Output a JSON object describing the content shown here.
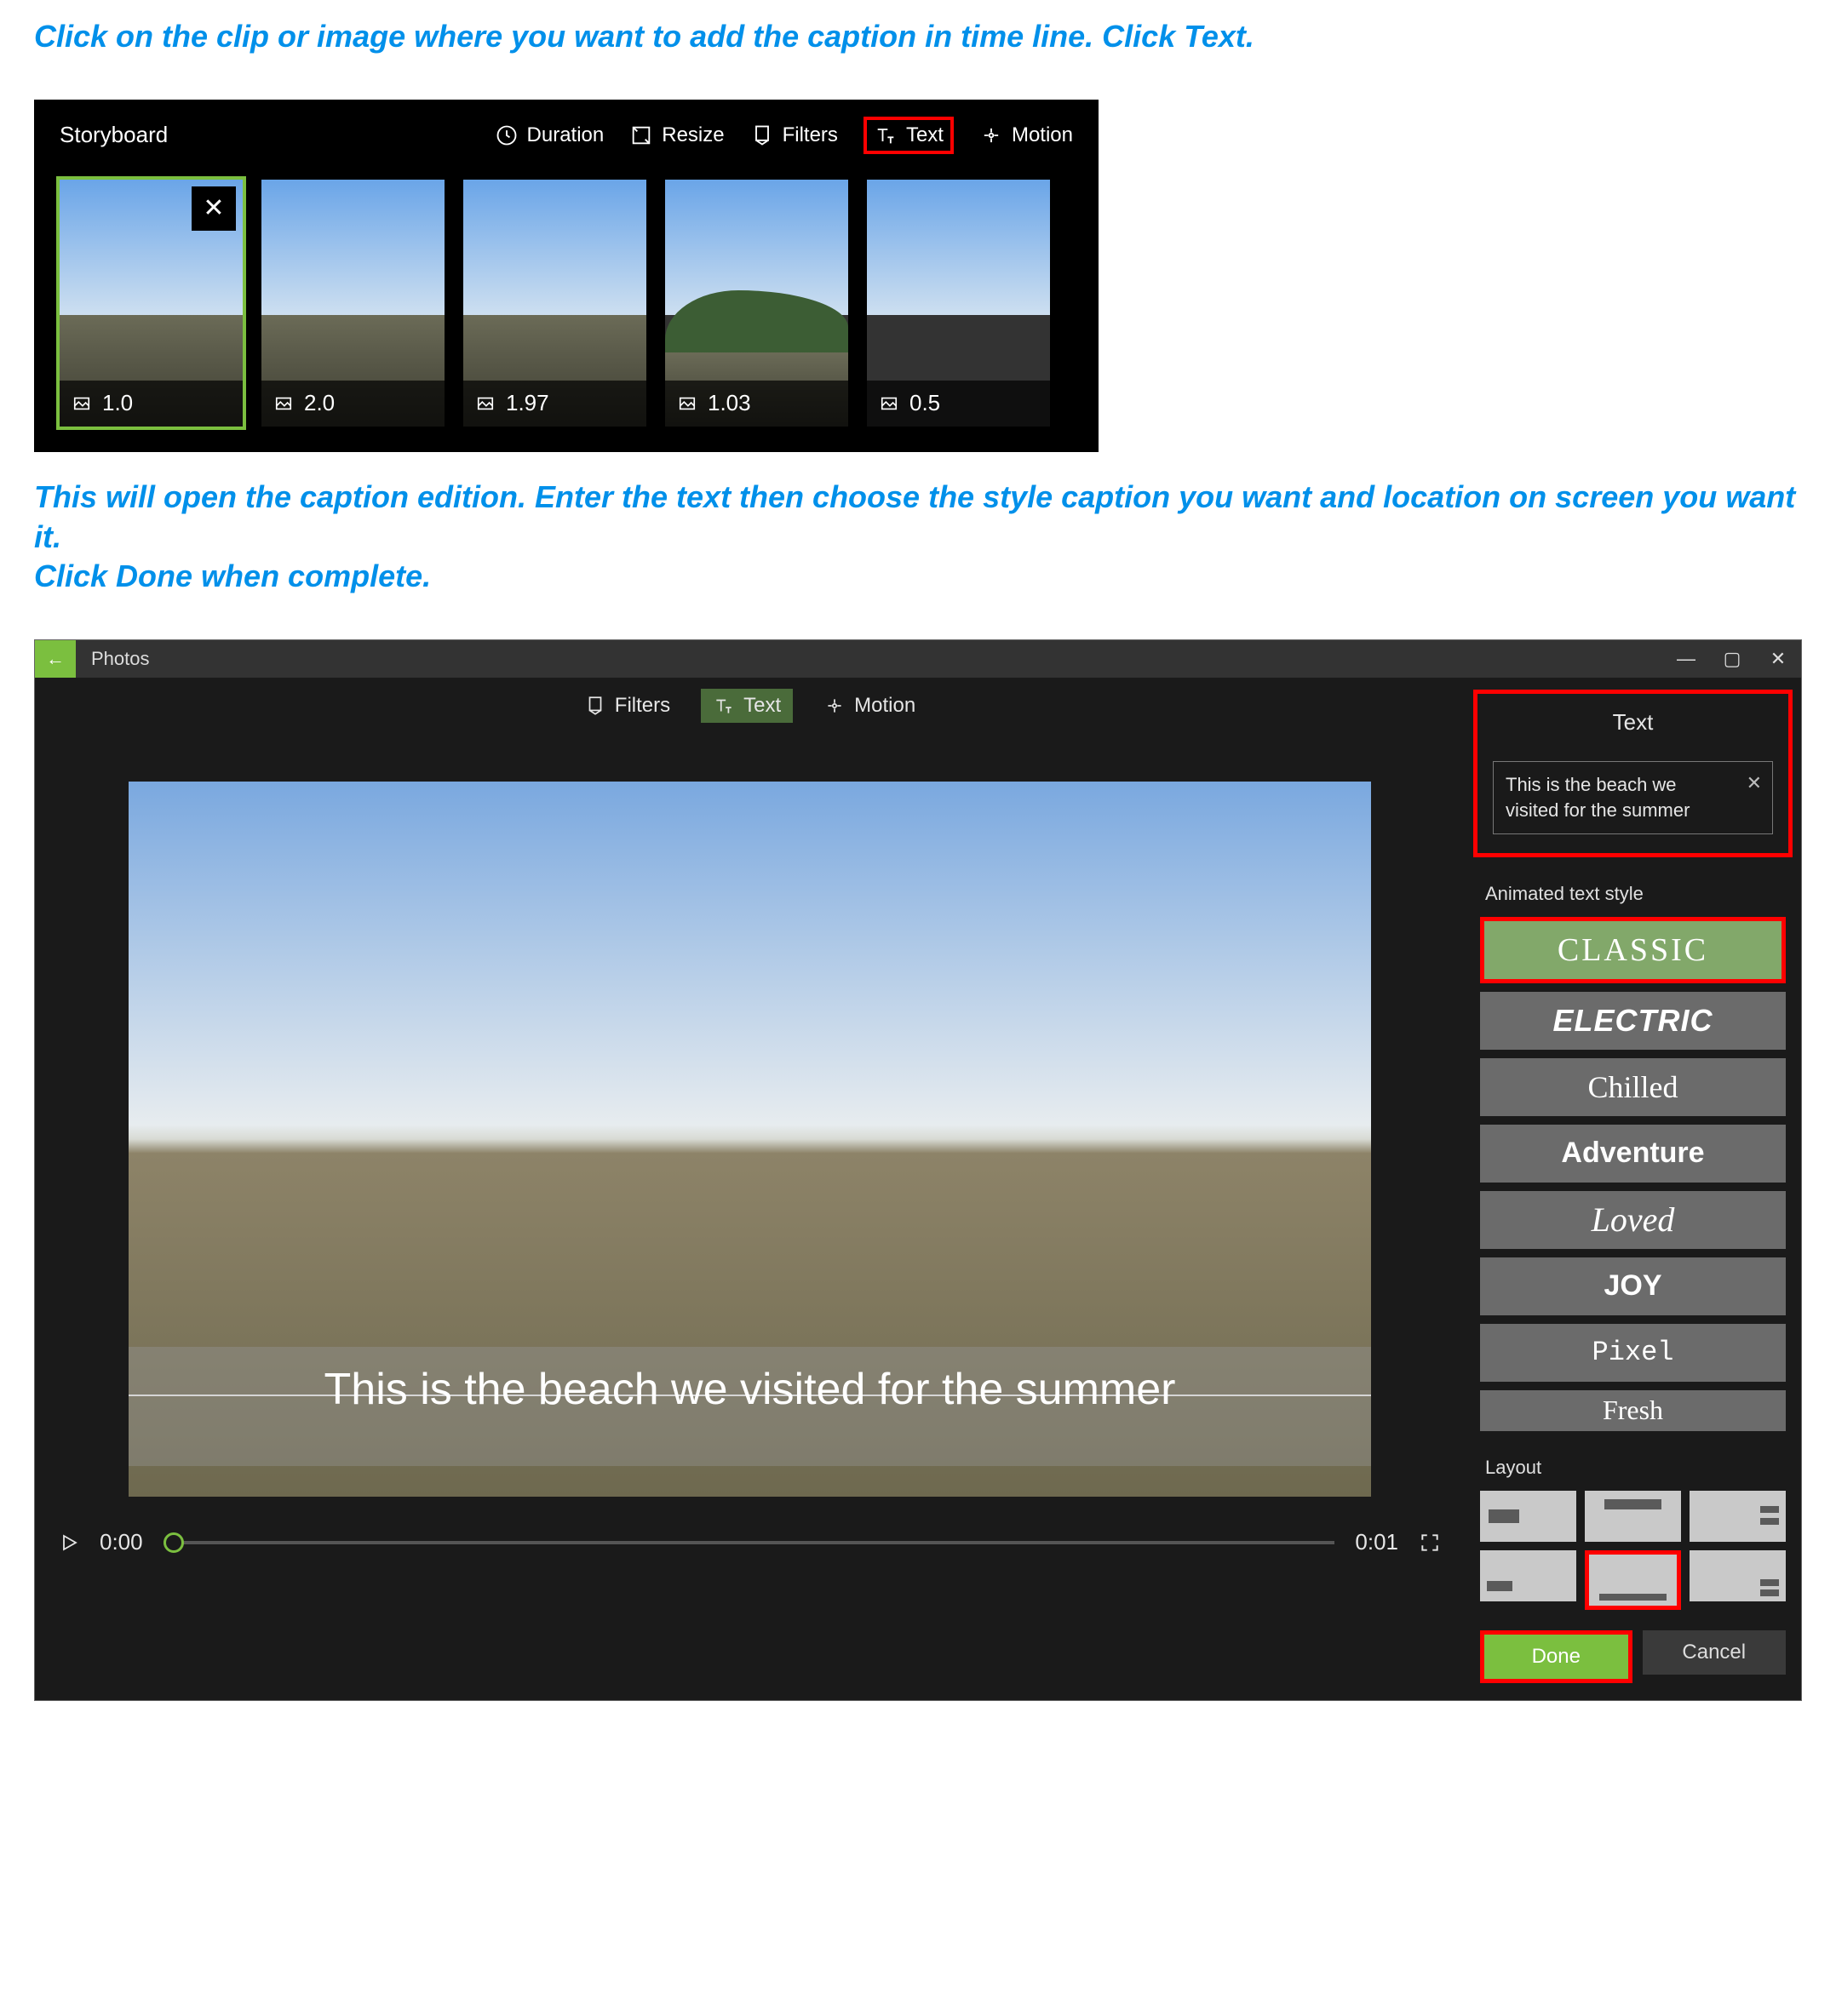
{
  "instruction1": "Click on the clip or image where you want to add the caption in time line. Click Text.",
  "instruction2_line1": "This will open the caption edition. Enter the text then choose the style caption you want and location on screen you want it.",
  "instruction2_line2": "Click Done when complete.",
  "storyboard": {
    "title": "Storyboard",
    "btn_duration": "Duration",
    "btn_resize": "Resize",
    "btn_filters": "Filters",
    "btn_text": "Text",
    "btn_motion": "Motion",
    "thumbs": [
      {
        "dur": "1.0",
        "selected": true,
        "has_close": true
      },
      {
        "dur": "2.0",
        "selected": false,
        "has_close": false
      },
      {
        "dur": "1.97",
        "selected": false,
        "has_close": false
      },
      {
        "dur": "1.03",
        "selected": false,
        "has_close": false
      },
      {
        "dur": "0.5",
        "selected": false,
        "has_close": false
      }
    ]
  },
  "photos": {
    "app_name": "Photos",
    "toolbar": {
      "filters": "Filters",
      "text": "Text",
      "motion": "Motion"
    },
    "caption_overlay": "This is the beach we visited for the summer",
    "play_time_start": "0:00",
    "play_time_end": "0:01",
    "text_panel": {
      "title": "Text",
      "value": "This is the beach we visited for the summer"
    },
    "style_section_label": "Animated text style",
    "styles": [
      {
        "label": "CLASSIC",
        "cls": "style-classic"
      },
      {
        "label": "ELECTRIC",
        "cls": "style-electric"
      },
      {
        "label": "Chilled",
        "cls": "style-chilled"
      },
      {
        "label": "Adventure",
        "cls": "style-adventure"
      },
      {
        "label": "Loved",
        "cls": "style-loved"
      },
      {
        "label": "JOY",
        "cls": "style-joy"
      },
      {
        "label": "Pixel",
        "cls": "style-pixel"
      },
      {
        "label": "Fresh",
        "cls": "style-fresh"
      }
    ],
    "layout_label": "Layout",
    "btn_done": "Done",
    "btn_cancel": "Cancel"
  }
}
